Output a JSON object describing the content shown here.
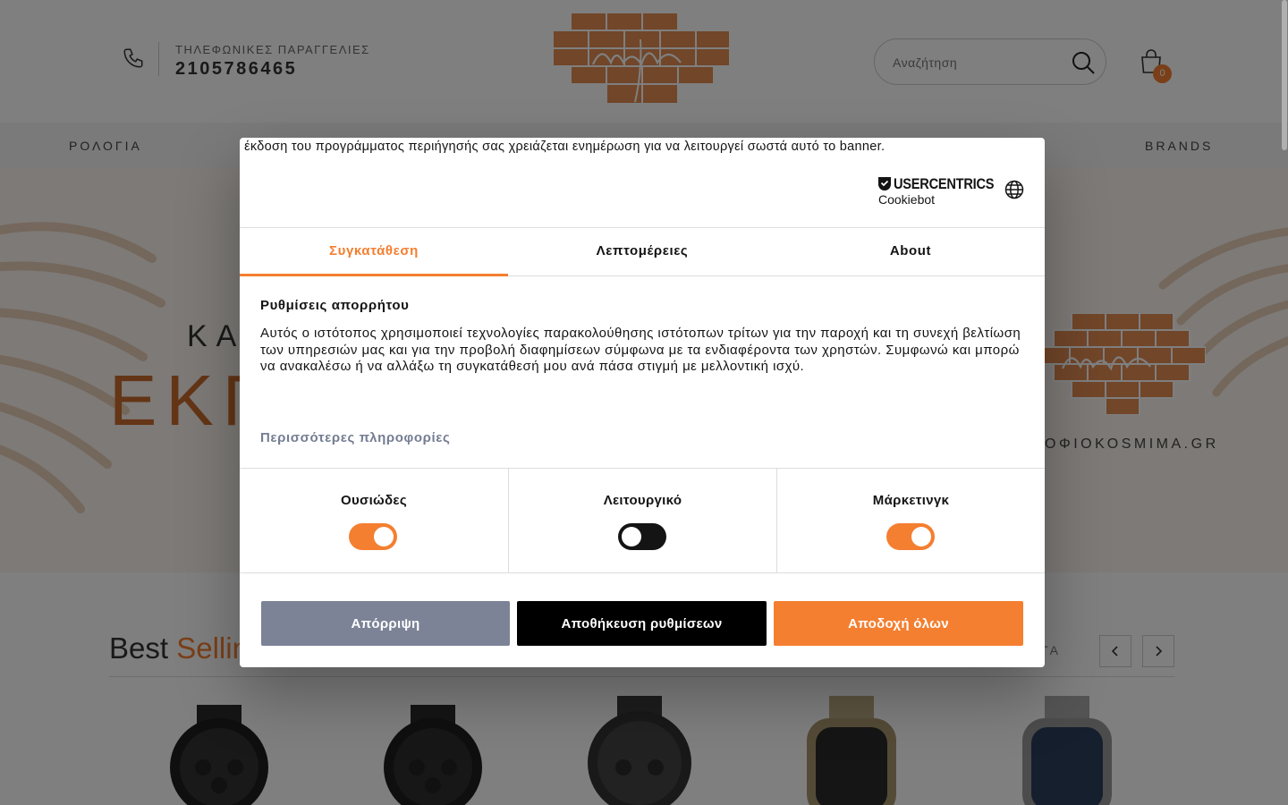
{
  "header": {
    "phone_label": "ΤΗΛΕΦΩΝΙΚΕΣ ΠΑΡΑΓΓΕΛΙΕΣ",
    "phone_number": "2105786465",
    "search_placeholder": "Αναζήτηση",
    "cart_count": "0"
  },
  "nav": {
    "items": [
      "ΡΟΛΟΓΙΑ",
      "BRANDS"
    ]
  },
  "hero": {
    "sub": "ΚΑ",
    "title": "ΕΚΠ",
    "url": "ΟΦΙΟΚΟSMIMA.GR"
  },
  "best_selling": {
    "title_a": "Best",
    "title_b": "Sellin",
    "view_all": "ΝΤΑ"
  },
  "cookie": {
    "browser_warning": "Η έκδοση του προγράμματος περιήγησής σας χρειάζεται ενημέρωση για να λειτουργεί σωστά αυτό το banner.",
    "brand_line1": "USERCENTRICS",
    "brand_line2": "Cookiebot",
    "tabs": [
      "Συγκατάθεση",
      "Λεπτομέρειες",
      "About"
    ],
    "heading": "Ρυθμίσεις απορρήτου",
    "description": "Αυτός ο ιστότοπος χρησιμοποιεί τεχνολογίες παρακολούθησης ιστότοπων τρίτων για την παροχή και τη συνεχή βελτίωση των υπηρεσιών μας και για την προβολή διαφημίσεων σύμφωνα με τα ενδιαφέροντα των χρηστών. Συμφωνώ και μπορώ να ανακαλέσω ή να αλλάξω τη συγκατάθεσή μου ανά πάσα στιγμή με μελλοντική ισχύ.",
    "more_info": "Περισσότερες πληροφορίες",
    "categories": [
      {
        "label": "Ουσιώδες",
        "enabled": true
      },
      {
        "label": "Λειτουργικό",
        "enabled": false
      },
      {
        "label": "Μάρκετινγκ",
        "enabled": true
      }
    ],
    "buttons": {
      "reject": "Απόρριψη",
      "save": "Αποθήκευση ρυθμίσεων",
      "accept": "Αποδοχή όλων"
    }
  },
  "colors": {
    "accent": "#f47f30",
    "reject_button": "#7c8397",
    "save_button": "#000000"
  }
}
